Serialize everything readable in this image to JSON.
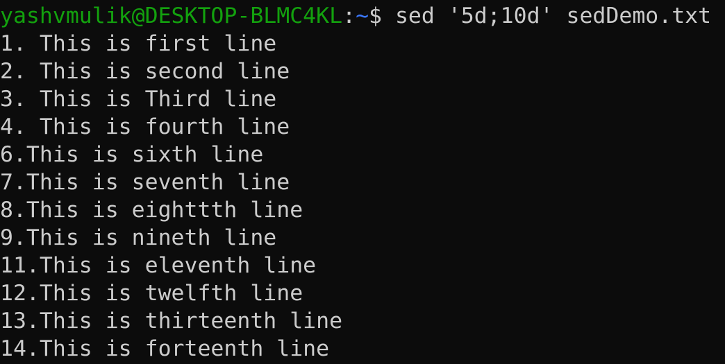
{
  "colors": {
    "background": "#0c0c0c",
    "foreground": "#cccccc",
    "prompt_user": "#13a10e",
    "prompt_path": "#3b78ff"
  },
  "prompt": {
    "user_host": "yashvmulik@DESKTOP-BLMC4KL",
    "separator": ":",
    "path": "~",
    "symbol": "$",
    "command": " sed '5d;10d' sedDemo.txt"
  },
  "output_lines": [
    "1. This is first line",
    "2. This is second line",
    "3. This is Third line",
    "4. This is fourth line",
    "6.This is sixth line",
    "7.This is seventh line",
    "8.This is eighttth line",
    "9.This is nineth line",
    "11.This is eleventh line",
    "12.This is twelfth line",
    "13.This is thirteenth line",
    "14.This is forteenth line"
  ]
}
